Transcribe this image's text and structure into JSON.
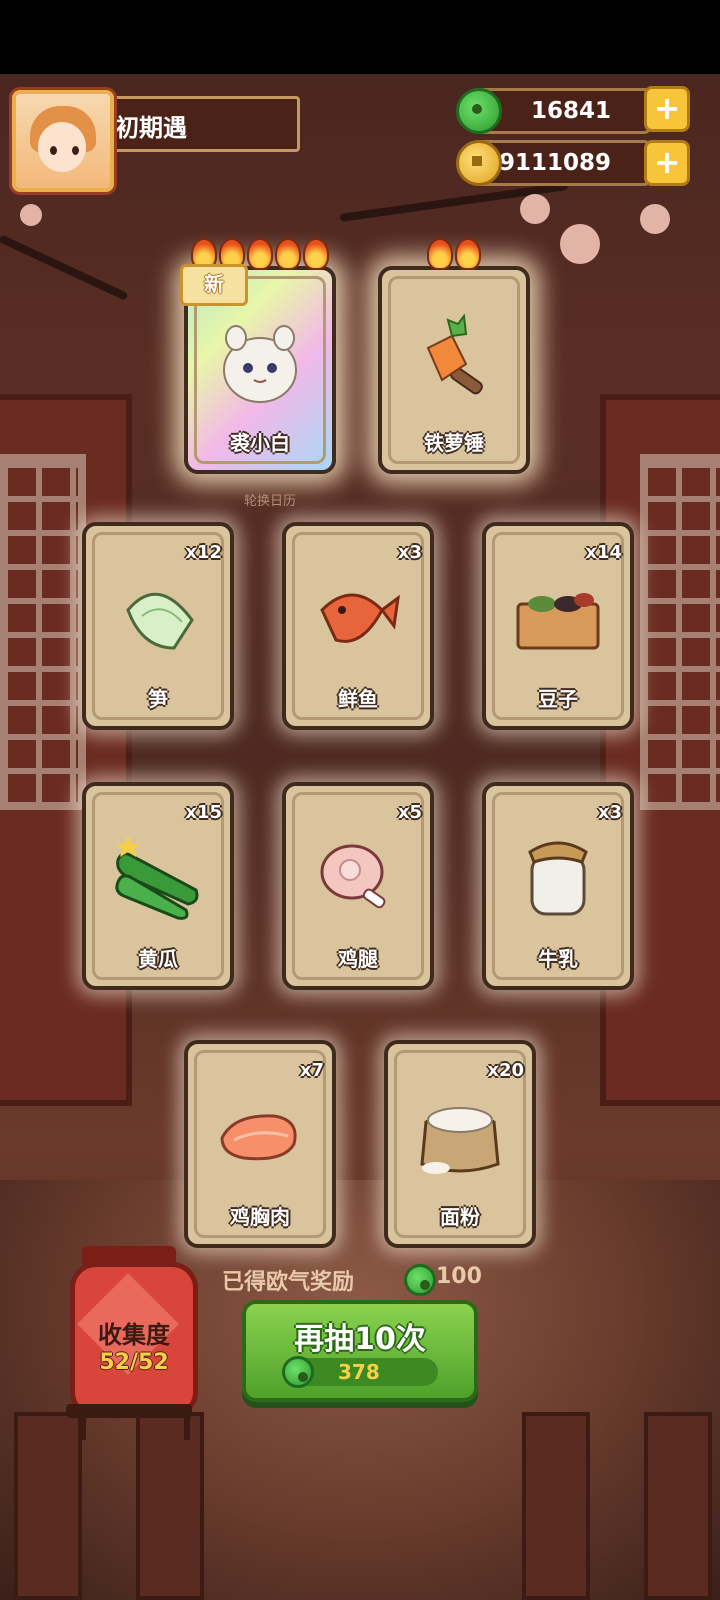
{
  "profile": {
    "name": "初期遇"
  },
  "currencies": [
    {
      "icon": "jade-icon",
      "value": "16841"
    },
    {
      "icon": "coin-icon",
      "value": "9111089"
    }
  ],
  "featured": [
    {
      "label": "裘小白",
      "badge": "新",
      "stars": 5
    },
    {
      "label": "铁萝锤",
      "stars": 2
    }
  ],
  "featured_caption": "轮换日历",
  "items": [
    {
      "label": "笋",
      "count": "x12"
    },
    {
      "label": "鲜鱼",
      "count": "x3"
    },
    {
      "label": "豆子",
      "count": "x14"
    },
    {
      "label": "黄瓜",
      "count": "x15"
    },
    {
      "label": "鸡腿",
      "count": "x5"
    },
    {
      "label": "牛乳",
      "count": "x3"
    },
    {
      "label": "鸡胸肉",
      "count": "x7"
    },
    {
      "label": "面粉",
      "count": "x20"
    }
  ],
  "reward": {
    "text": "已得欧气奖励",
    "value": "100"
  },
  "collection": {
    "title": "收集度",
    "value": "52/52"
  },
  "draw": {
    "label": "再抽10次",
    "cost": "378"
  },
  "colors": {
    "accent_green": "#4ea12a",
    "card_bg": "#d9c49e",
    "gold": "#f7c43a"
  }
}
